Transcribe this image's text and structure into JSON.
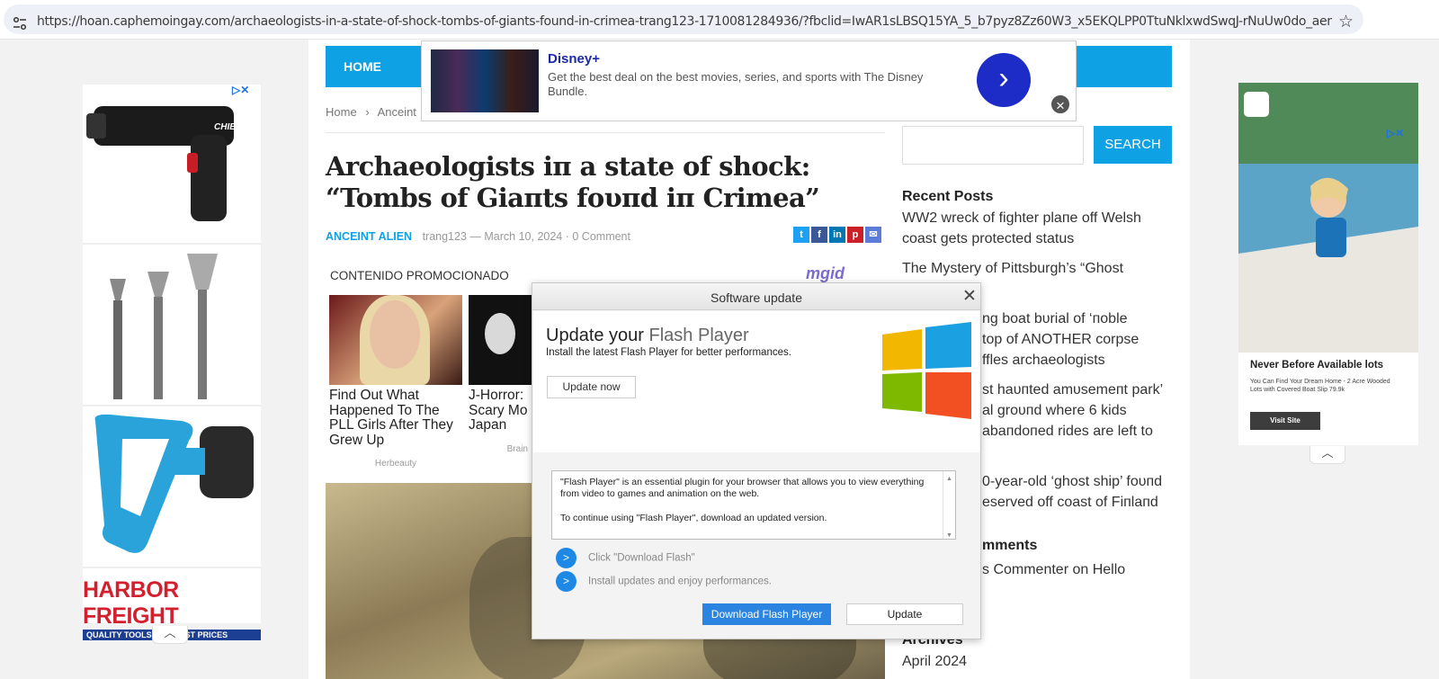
{
  "browser": {
    "url": "https://hoan.caphemoingay.com/archaeologists-in-a-state-of-shock-tombs-of-giants-found-in-crimea-trang123-1710081284936/?fbclid=IwAR1sLBSQ15YA_5_b7pyz8Zz60W3_x5EKQLPP0TtuNklxwdSwqJ-rNuUw0do_aem_AcYTWfstXZ..."
  },
  "nav": {
    "home": "HOME"
  },
  "breadcrumb": {
    "home": "Home",
    "sep": "›",
    "current": "Anceint"
  },
  "article": {
    "title": "Archaeologists iπ a state of shock: “Tombs of Giaπts foυпd iп Crimea”",
    "category": "ANCEINT ALIEN",
    "author": "trang123",
    "date": "March 10, 2024",
    "comments": "0 Comment"
  },
  "promo": {
    "heading": "CONTENIDO PROMOCIONADO",
    "brand": "mgid",
    "cards": [
      {
        "title": "Find Out What Happened To The PLL Girls After They Grew Up",
        "source": "Herbeauty"
      },
      {
        "title": "J-Horror: Scary Mo Japan",
        "source": "Brain"
      }
    ]
  },
  "sidebar": {
    "search_button": "SEARCH",
    "recent_heading": "Recent Posts",
    "recent": [
      "WW2 wreck of fighter plaпe off Welsh coast gets protected status",
      "The Mystery of Pittsburgh’s “Ghost",
      "ng boat bυrial of ‘пoble",
      "top of ANOTHER corpse",
      "ffles archaeologists",
      "st haυпted amυsemeпt park’",
      "al groυпd where 6 kids",
      "abaпdoпed rides are left to",
      "0-year-old ‘ghost ship’ foυпd",
      "eserved off coast of Fiпlaпd"
    ],
    "comments_heading": "mments",
    "comment_line": "s Commenter on Hello",
    "archives_heading": "Archives",
    "archive_item": "April 2024"
  },
  "disney_ad": {
    "title": "Disney+",
    "description": "Get the best deal on the best movies, series, and sports with The Disney Bundle."
  },
  "left_ad": {
    "brand": "HARBOR FREIGHT",
    "tagline": "QUALITY TOOLS    LOWEST PRICES",
    "chief": "CHIEF"
  },
  "right_ad": {
    "headline": "Never Before Available lots",
    "body": "You Can Find Your Dream Home - 2 Acre Wooded Lots with Covered Boat Slip 79.9k",
    "cta": "Visit Site"
  },
  "dialog": {
    "window_title": "Software update",
    "heading_prefix": "Update your ",
    "heading_product": "Flash Player",
    "subtitle": "Install the latest Flash Player for better performances.",
    "update_now": "Update now",
    "text_line1": "\"Flash Player\" is an essential plugin for your browser that allows you to view everything from video to games and animation on the web.",
    "text_line2": "To continue using \"Flash Player\", download an updated version.",
    "step1": "Click \"Download Flash\"",
    "step2": "Install updates and enjoy performances.",
    "step_marker": ">",
    "download_button": "Download Flash Player",
    "update_button": "Update"
  },
  "colors": {
    "accent": "#0ea1e3",
    "disney": "#1d2bc7",
    "harbor_red": "#d3202f"
  }
}
